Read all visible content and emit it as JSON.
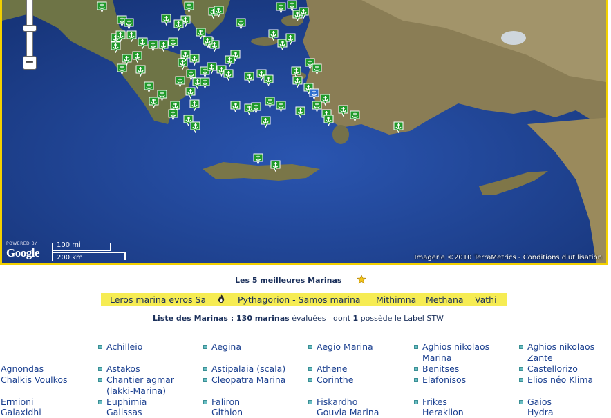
{
  "map": {
    "zoom": {
      "minus_label": "−"
    },
    "logo": {
      "powered": "POWERED BY",
      "word": "Google"
    },
    "scale": {
      "miles": "100 mi",
      "km": "200 km"
    },
    "attribution": "Imagerie ©2010 TerraMetrics - Conditions d'utilisation"
  },
  "best": {
    "title": "Les 5 meilleures Marinas",
    "items": [
      "Leros marina evros Sa",
      "Pythagorion - Samos marina",
      "Mithimna",
      "Methana",
      "Vathi"
    ]
  },
  "summary": {
    "prefix": "Liste des Marinas : ",
    "count": "130 marinas",
    "evaluated": " évaluées",
    "dont": "dont ",
    "label_count": "1",
    "suffix": " possède le Label STW"
  },
  "marinas": {
    "row1": [
      "Achilleio",
      "Aegina",
      "Aegio Marina",
      "Aghios nikolaos",
      "Aghios nikolaos"
    ],
    "row1b": [
      "Marina",
      "Zante"
    ],
    "row2": [
      "Agnondas",
      "Astakos",
      "Astipalaia (scala)",
      "Athene",
      "Benitses",
      "Castellorizo"
    ],
    "row3": [
      "Chalkis Voulkos",
      "Chantier agmar",
      "Cleopatra Marina",
      "Corinthe",
      "Elafonisos",
      "Elios néo Klima"
    ],
    "row3b": [
      "(lakki-Marina)"
    ],
    "row4": [
      "Ermioni",
      "Euphimia",
      "Faliron",
      "Fiskardho",
      "Frikes",
      "Gaios"
    ],
    "row5": [
      "Galaxidhi",
      "Galissas",
      "Githion",
      "Gouvia Marina",
      "Heraklion",
      "Hydra"
    ]
  }
}
